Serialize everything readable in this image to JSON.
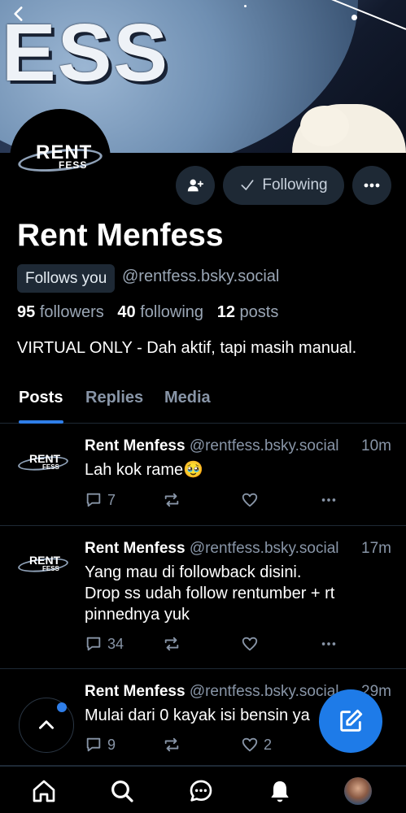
{
  "header": {
    "banner_text": "ESS",
    "back_icon": "chevron-left-icon"
  },
  "profile": {
    "avatar_logo": {
      "line1": "RENT",
      "line2": "FESS"
    },
    "display_name": "Rent Menfess",
    "follows_you_label": "Follows you",
    "handle": "@rentfess.bsky.social",
    "followers_count": "95",
    "followers_label": "followers",
    "following_count": "40",
    "following_label": "following",
    "posts_count": "12",
    "posts_label": "posts",
    "bio": "VIRTUAL ONLY - Dah aktif, tapi masih manual.",
    "following_button_label": "Following"
  },
  "tabs": [
    {
      "label": "Posts",
      "active": true
    },
    {
      "label": "Replies",
      "active": false
    },
    {
      "label": "Media",
      "active": false
    }
  ],
  "posts": [
    {
      "author": "Rent Menfess",
      "handle": "@rentfess.bsky.social",
      "time": "10m",
      "text": "Lah kok rame🥹",
      "replies": "7",
      "reposts": "",
      "likes": ""
    },
    {
      "author": "Rent Menfess",
      "handle": "@rentfess.bsky.social",
      "time": "17m",
      "text": "Yang mau di followback disini.\nDrop ss udah follow rentumber + rt pinnednya yuk",
      "replies": "34",
      "reposts": "",
      "likes": ""
    },
    {
      "author": "Rent Menfess",
      "handle": "@rentfess.bsky.social",
      "time": "29m",
      "text": "Mulai dari 0 kayak isi bensin ya",
      "replies": "9",
      "reposts": "",
      "likes": "2"
    }
  ],
  "colors": {
    "accent": "#1e7be8",
    "muted": "#8895a7",
    "surface": "#1e2935",
    "background": "#000000"
  },
  "bottom_nav": [
    {
      "icon": "home-icon"
    },
    {
      "icon": "search-icon"
    },
    {
      "icon": "chat-icon"
    },
    {
      "icon": "bell-icon"
    },
    {
      "icon": "profile-avatar"
    }
  ]
}
